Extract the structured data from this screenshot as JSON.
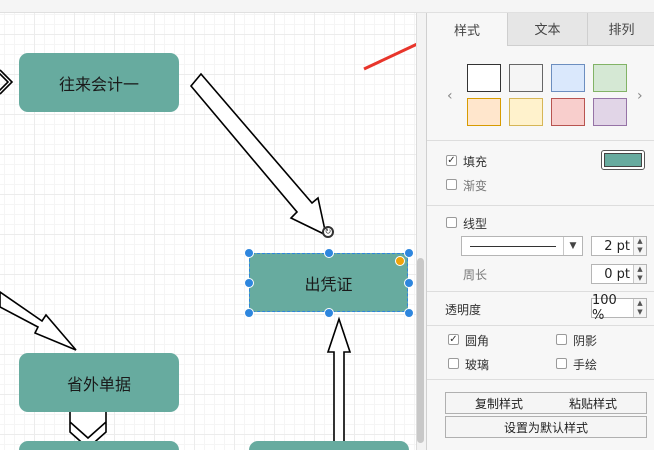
{
  "diagram": {
    "nodes": [
      {
        "id": "n1",
        "label": "往来会计一"
      },
      {
        "id": "n2",
        "label": "出凭证"
      },
      {
        "id": "n3",
        "label": "省外单据"
      },
      {
        "id": "n4",
        "label": ""
      },
      {
        "id": "n5",
        "label": ""
      }
    ],
    "fill_color": "#67ab9f",
    "selection_color": "#2e86de",
    "annotation_arrow_color": "#e8352b"
  },
  "panel": {
    "tabs": [
      {
        "label": "样式",
        "active": true
      },
      {
        "label": "文本",
        "active": false
      },
      {
        "label": "排列",
        "active": false
      }
    ],
    "swatches": [
      {
        "fill": "#ffffff",
        "border": "#333333"
      },
      {
        "fill": "#f5f5f5",
        "border": "#666666"
      },
      {
        "fill": "#dae8fc",
        "border": "#6c8ebf"
      },
      {
        "fill": "#d5e8d4",
        "border": "#82b366"
      },
      {
        "fill": "#ffe6cc",
        "border": "#d79b00"
      },
      {
        "fill": "#fff2cc",
        "border": "#d6b656"
      },
      {
        "fill": "#f8cecc",
        "border": "#b85450"
      },
      {
        "fill": "#e1d5e7",
        "border": "#9673a6"
      }
    ],
    "fill": {
      "label": "填充",
      "checked": true,
      "color": "#67ab9f"
    },
    "gradient": {
      "label": "渐变",
      "checked": false
    },
    "line": {
      "label": "线型",
      "checked": false,
      "width": "2 pt"
    },
    "perimeter": {
      "label": "周长",
      "value": "0 pt"
    },
    "opacity": {
      "label": "透明度",
      "value": "100 %"
    },
    "rounded": {
      "label": "圆角",
      "checked": true
    },
    "shadow": {
      "label": "阴影",
      "checked": false
    },
    "glass": {
      "label": "玻璃",
      "checked": false
    },
    "sketch": {
      "label": "手绘",
      "checked": false
    },
    "buttons": {
      "copy_style": "复制样式",
      "paste_style": "粘贴样式",
      "set_default": "设置为默认样式"
    }
  }
}
